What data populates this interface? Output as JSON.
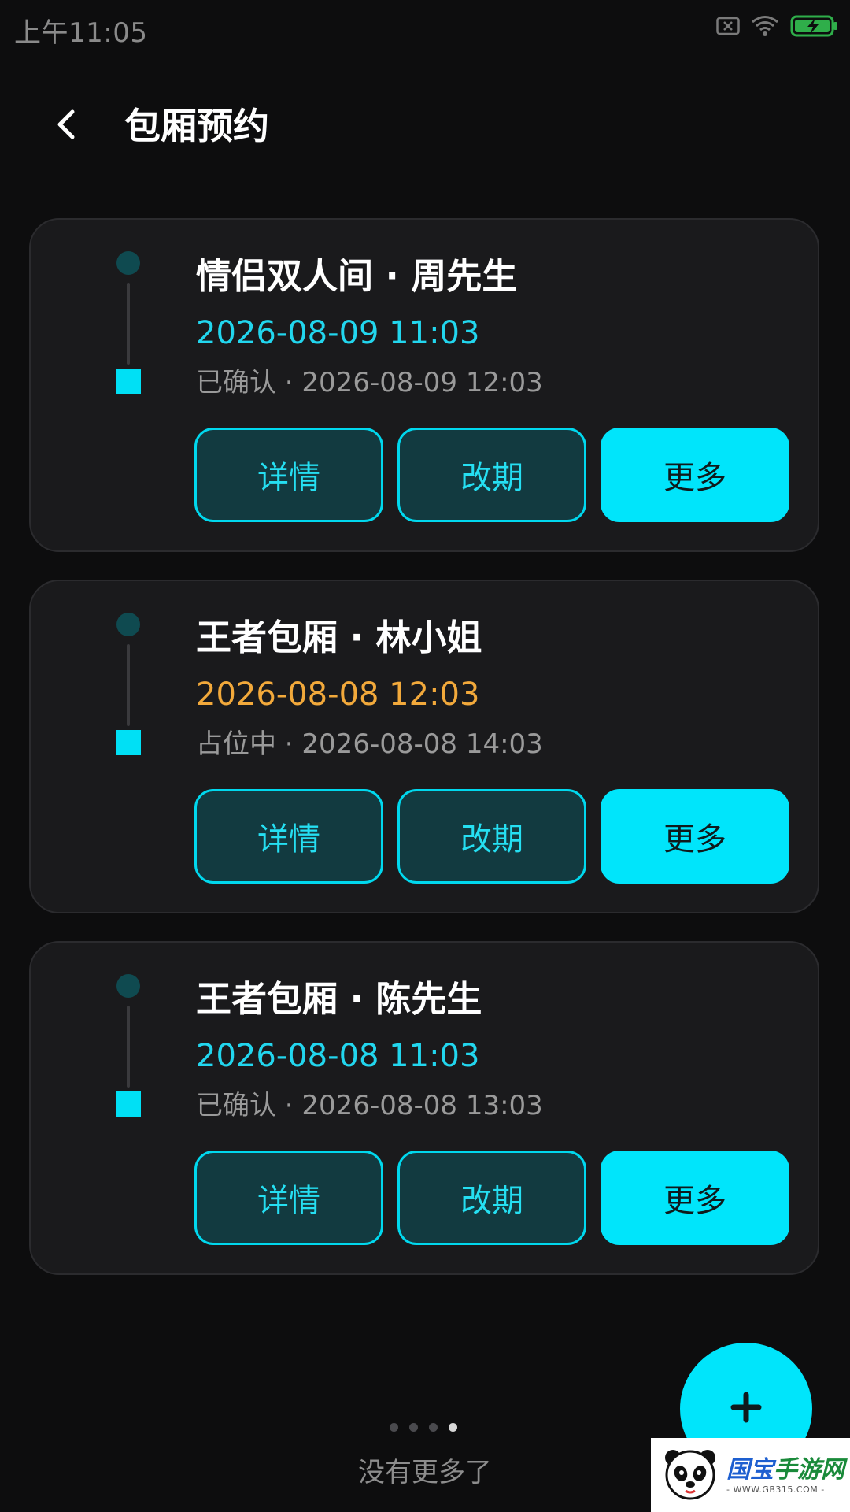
{
  "status_bar": {
    "time": "上午11:05"
  },
  "header": {
    "back_icon": "chevron-left-icon",
    "title": "包厢预约"
  },
  "colors": {
    "accent": "#00e5fb",
    "confirmed_time": "#22d6ee",
    "holding_time": "#f2a93b",
    "background": "#0d0d0e",
    "card": "#1a1a1c"
  },
  "bookings": [
    {
      "title": "情侣双人间 · 周先生",
      "time": "2026-08-09 11:03",
      "time_color": "#22d6ee",
      "status": "已确认 · 2026-08-09 12:03",
      "buttons": [
        "详情",
        "改期",
        "更多"
      ]
    },
    {
      "title": "王者包厢 · 林小姐",
      "time": "2026-08-08 12:03",
      "time_color": "#f2a93b",
      "status": "占位中 · 2026-08-08 14:03",
      "buttons": [
        "详情",
        "改期",
        "更多"
      ]
    },
    {
      "title": "王者包厢 · 陈先生",
      "time": "2026-08-08 11:03",
      "time_color": "#22d6ee",
      "status": "已确认 · 2026-08-08 13:03",
      "buttons": [
        "详情",
        "改期",
        "更多"
      ]
    }
  ],
  "pager": {
    "total": 4,
    "active_index": 3
  },
  "footer": {
    "no_more": "没有更多了"
  },
  "fab": {
    "icon": "plus-icon"
  },
  "watermark": {
    "brand_part1": "国宝",
    "brand_part2": "手游网",
    "url": "- WWW.GB315.COM -"
  }
}
